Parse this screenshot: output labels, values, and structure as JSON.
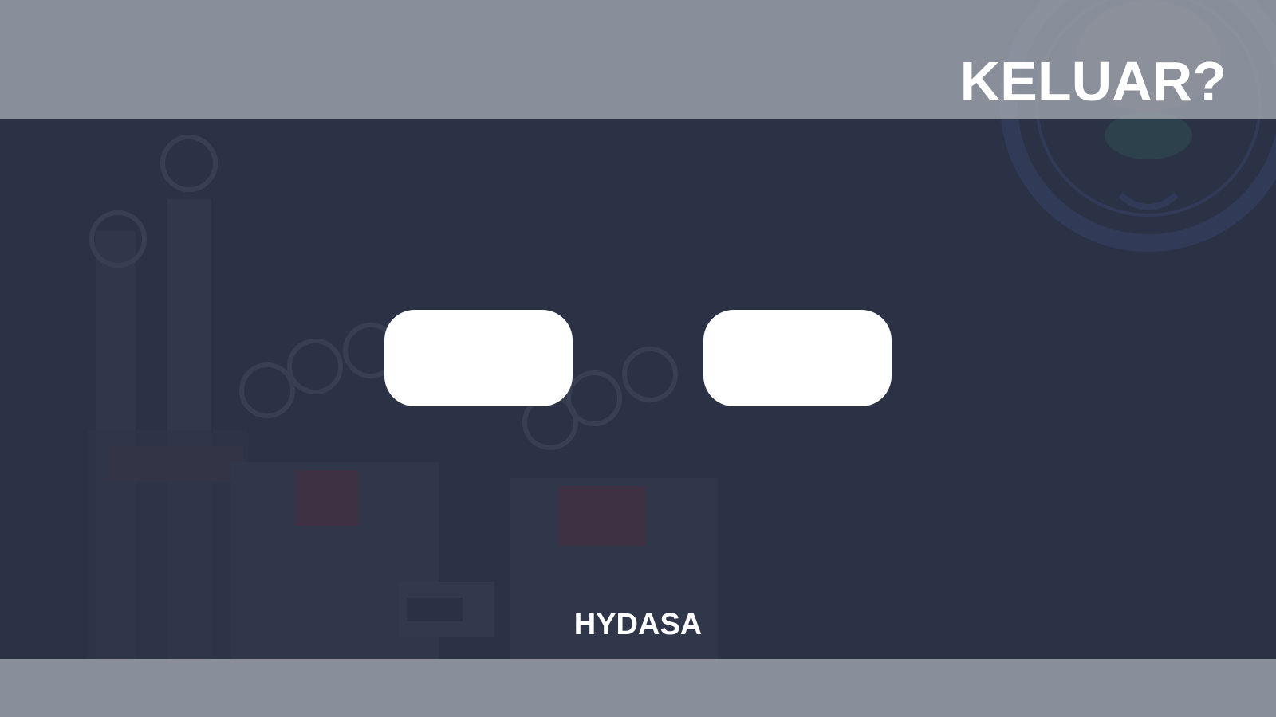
{
  "dialog": {
    "title": "KELUAR?",
    "buttons": [
      {
        "label": ""
      },
      {
        "label": ""
      }
    ]
  },
  "footer": {
    "brand": "HYDASA"
  },
  "colors": {
    "background": "#2b3245",
    "band": "#969ca6",
    "button": "#ffffff",
    "text": "#ffffff"
  },
  "decorations": {
    "background_image": "hydraulic-equipment-illustration",
    "emblem": "university-seal-watermark"
  }
}
